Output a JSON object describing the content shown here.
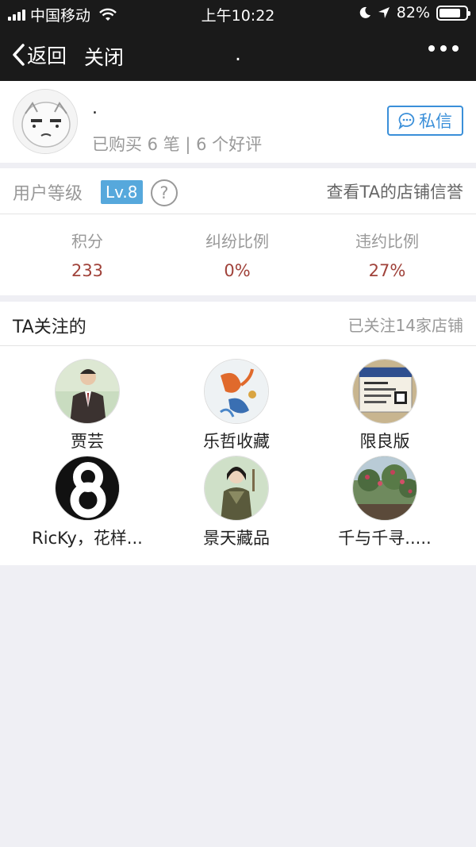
{
  "status_bar": {
    "carrier": "中国移动",
    "time": "上午10:22",
    "battery": "82%",
    "battery_level": 0.82
  },
  "nav": {
    "back_label": "返回",
    "close_label": "关闭",
    "title": ".",
    "more_icon": "more-dots-icon"
  },
  "profile": {
    "name": ".",
    "stats": "已购买 6 笔 | 6 个好评",
    "message_label": "私信",
    "message_icon": "chat-bubble-icon"
  },
  "level": {
    "label": "用户等级",
    "badge": "Lv.8",
    "help_icon": "question-icon",
    "credit_link": "查看TA的店铺信誉",
    "metrics": [
      {
        "label": "积分",
        "value": "233"
      },
      {
        "label": "纠纷比例",
        "value": "0%"
      },
      {
        "label": "违约比例",
        "value": "27%"
      }
    ]
  },
  "following": {
    "title": "TA关注的",
    "count_text": "已关注14家店铺",
    "stores": [
      {
        "name": "贾芸"
      },
      {
        "name": "乐哲收藏"
      },
      {
        "name": "限良版"
      },
      {
        "name": "RicKy，花样..."
      },
      {
        "name": "景天藏品"
      },
      {
        "name": "千与千寻....."
      }
    ]
  },
  "colors": {
    "nav_bg": "#1a1a1a",
    "accent_blue": "#3a8fd9",
    "badge_blue": "#56a8dc",
    "value_red": "#a0423a"
  }
}
